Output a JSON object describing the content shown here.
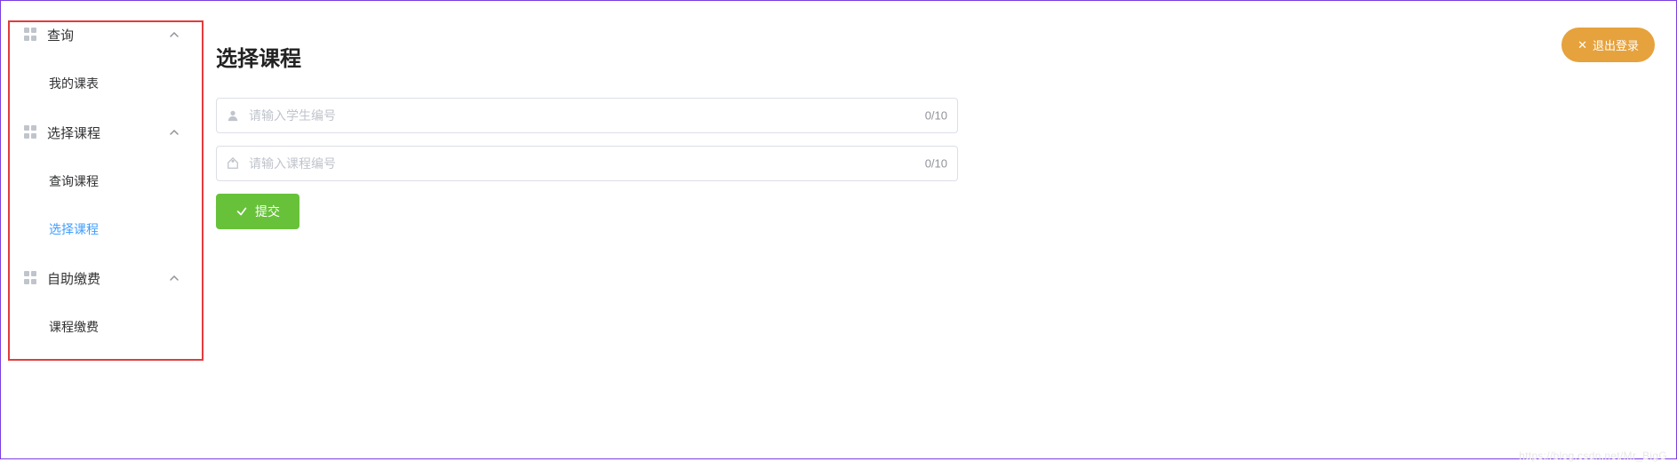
{
  "sidebar": {
    "groups": [
      {
        "label": "查询",
        "items": [
          {
            "label": "我的课表",
            "active": false
          }
        ]
      },
      {
        "label": "选择课程",
        "items": [
          {
            "label": "查询课程",
            "active": false
          },
          {
            "label": "选择课程",
            "active": true
          }
        ]
      },
      {
        "label": "自助缴费",
        "items": [
          {
            "label": "课程缴费",
            "active": false
          }
        ]
      }
    ]
  },
  "header": {
    "title": "选择课程",
    "logout_label": "退出登录"
  },
  "form": {
    "student_id": {
      "value": "",
      "placeholder": "请输入学生编号",
      "counter": "0/10"
    },
    "course_id": {
      "value": "",
      "placeholder": "请输入课程编号",
      "counter": "0/10"
    },
    "submit_label": "提交"
  },
  "watermark": "https://blog.csdn.net/Mr_BigG"
}
